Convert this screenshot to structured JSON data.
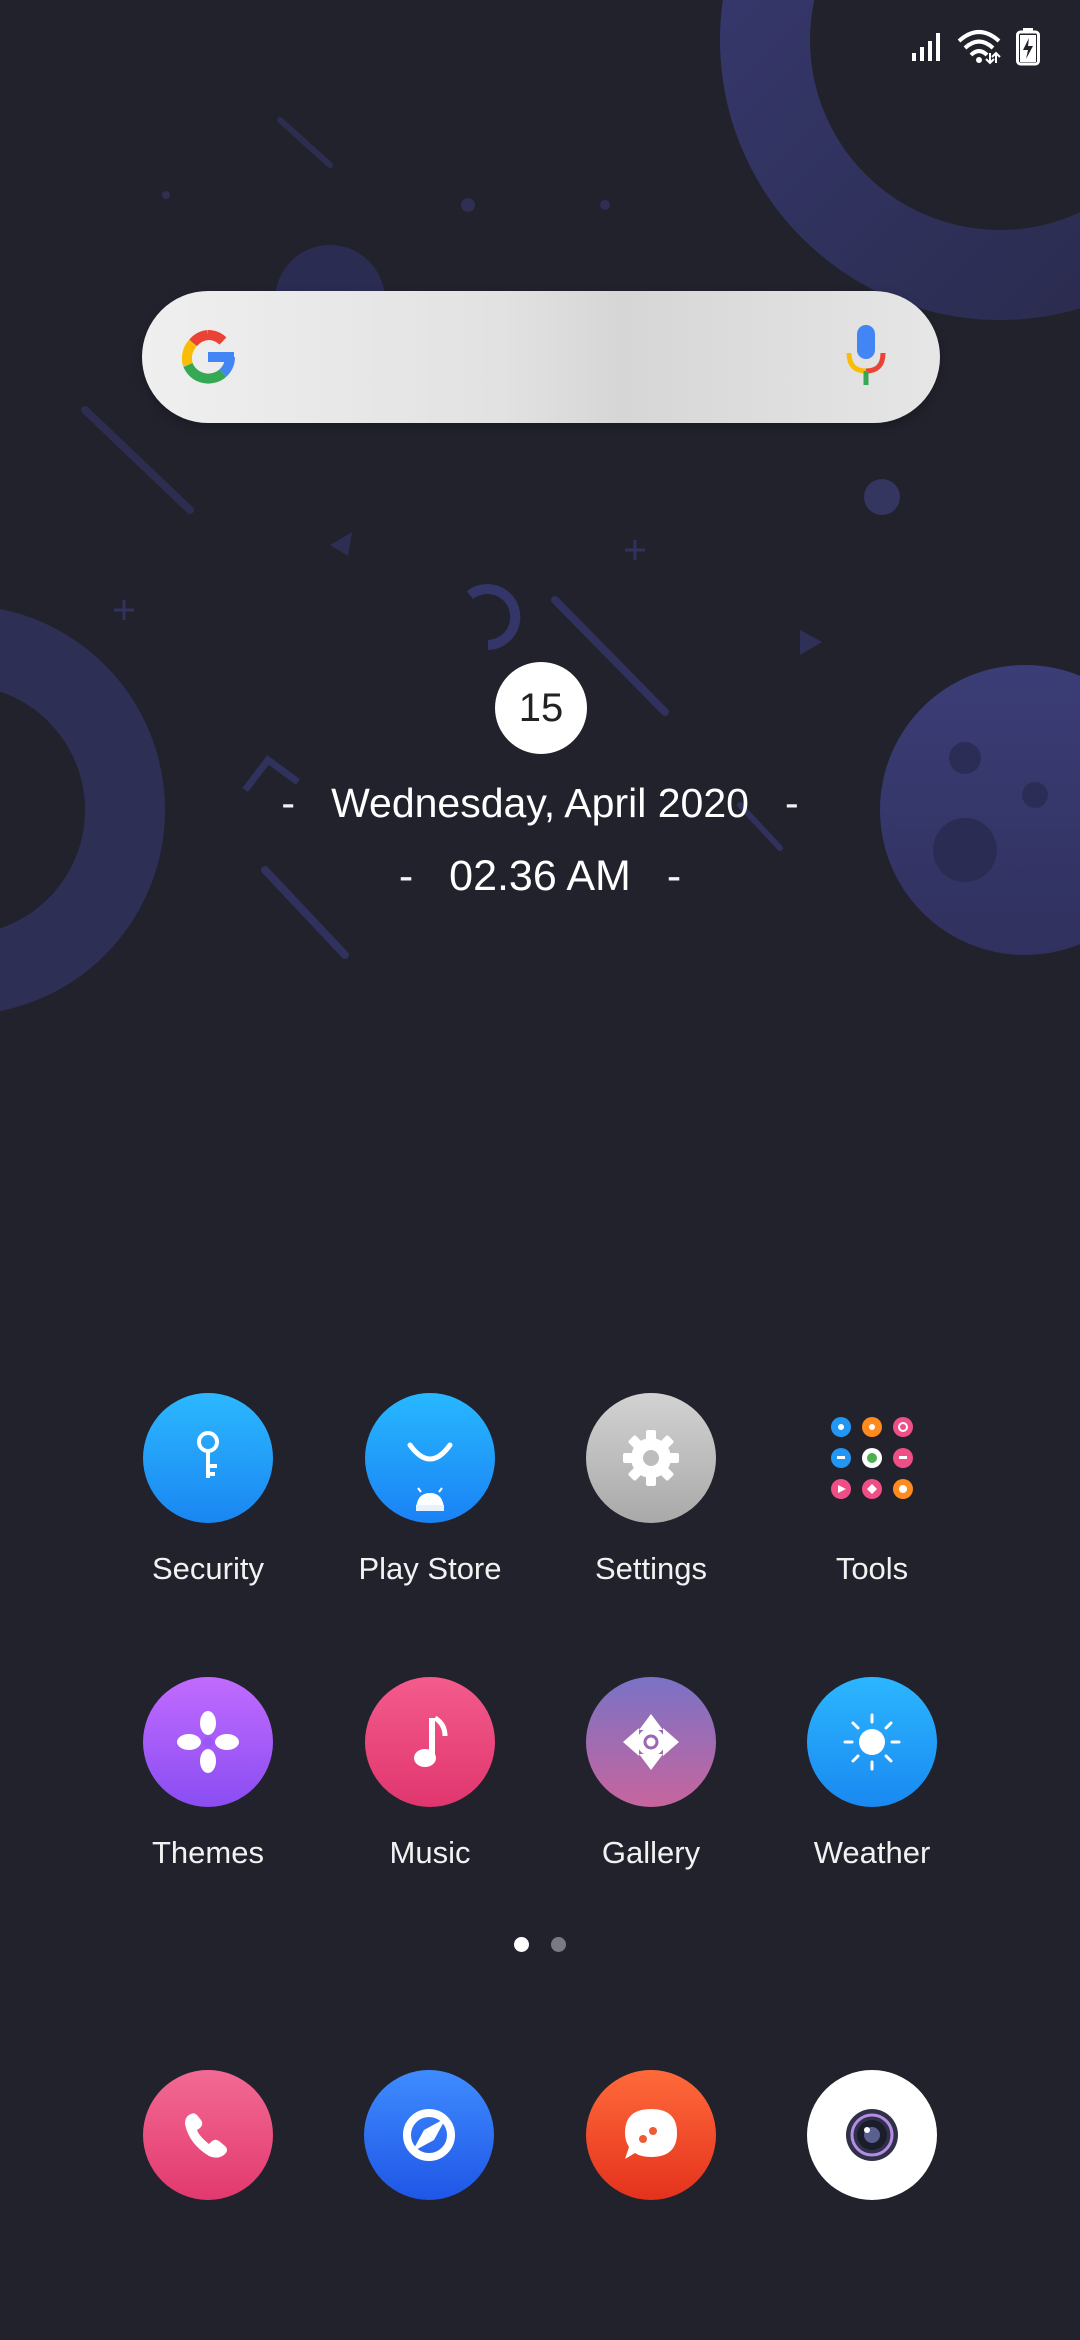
{
  "status_bar": {
    "icons": [
      "signal-icon",
      "wifi-icon",
      "battery-charging-icon"
    ]
  },
  "search": {
    "logo": "google-g-icon",
    "voice": "microphone-icon"
  },
  "clock": {
    "day": "15",
    "date": "Wednesday, April 2020",
    "time": "02.36 AM",
    "separator": "-"
  },
  "apps": [
    {
      "label": "Security",
      "icon": "key-icon"
    },
    {
      "label": "Play Store",
      "icon": "play-store-icon"
    },
    {
      "label": "Settings",
      "icon": "gear-icon"
    },
    {
      "label": "Tools",
      "icon": "tools-grid-icon"
    },
    {
      "label": "Themes",
      "icon": "themes-flower-icon"
    },
    {
      "label": "Music",
      "icon": "music-note-icon"
    },
    {
      "label": "Gallery",
      "icon": "gallery-flower-icon"
    },
    {
      "label": "Weather",
      "icon": "sun-icon"
    }
  ],
  "page_indicator": {
    "pages": 2,
    "active": 1
  },
  "dock": [
    {
      "name": "phone",
      "icon": "phone-icon"
    },
    {
      "name": "browser",
      "icon": "compass-icon"
    },
    {
      "name": "messages",
      "icon": "chat-bubble-icon"
    },
    {
      "name": "camera",
      "icon": "camera-lens-icon"
    }
  ],
  "colors": {
    "background": "#21222c",
    "wallpaper_shape": "#383a72",
    "security": "#1f9bf7",
    "music": "#ea4a7e",
    "themes": "#a95cf8",
    "messages": "#f24b2b"
  }
}
